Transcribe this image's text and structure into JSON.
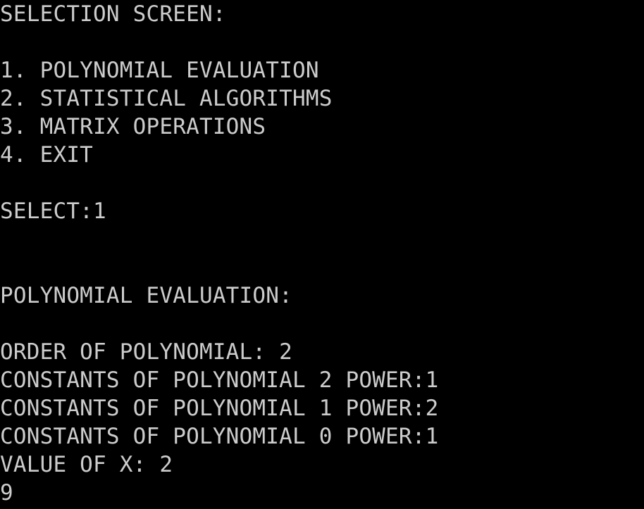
{
  "theme": {
    "background": "#000000",
    "text_color": "#cccccc"
  },
  "menu": {
    "title": "SELECTION SCREEN:",
    "options": [
      "1. POLYNOMIAL EVALUATION",
      "2. STATISTICAL ALGORITHMS",
      "3. MATRIX OPERATIONS",
      "4. EXIT"
    ],
    "select_prompt": "SELECT:1"
  },
  "polynomial": {
    "title": "POLYNOMIAL EVALUATION:",
    "order_line": "ORDER OF POLYNOMIAL: 2",
    "constant_lines": [
      "CONSTANTS OF POLYNOMIAL 2 POWER:1",
      "CONSTANTS OF POLYNOMIAL 1 POWER:2",
      "CONSTANTS OF POLYNOMIAL 0 POWER:1"
    ],
    "x_value_line": "VALUE OF X: 2",
    "result": "9"
  }
}
